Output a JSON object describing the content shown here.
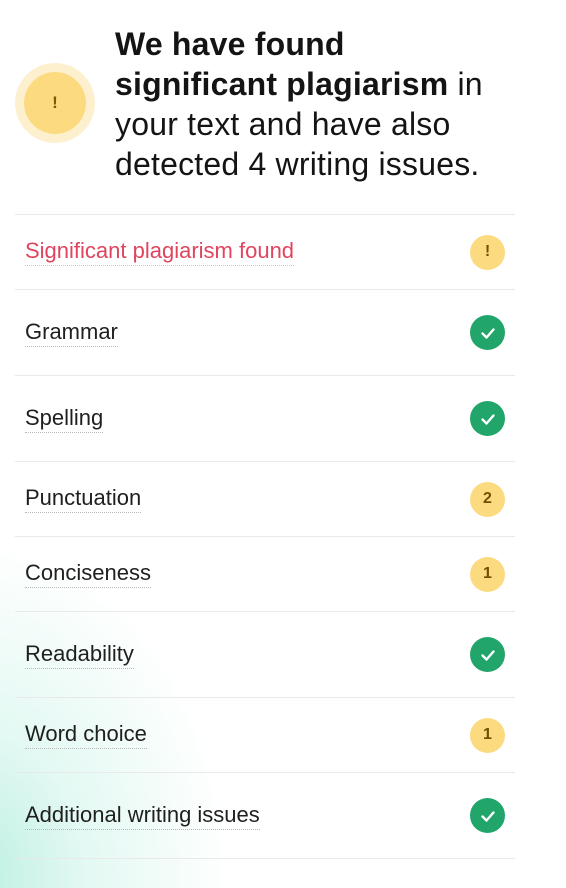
{
  "header": {
    "badge_icon": "!",
    "headline_bold_1": "We have found",
    "headline_bold_2": "significant plagiarism",
    "headline_rest_1": " in",
    "headline_rest_2": "your text and have also",
    "headline_rest_3": "detected 4 writing issues."
  },
  "checks": [
    {
      "label": "Significant plagiarism found",
      "status": "warning",
      "badge": "!"
    },
    {
      "label": "Grammar",
      "status": "ok",
      "badge": ""
    },
    {
      "label": "Spelling",
      "status": "ok",
      "badge": ""
    },
    {
      "label": "Punctuation",
      "status": "issues",
      "badge": "2"
    },
    {
      "label": "Conciseness",
      "status": "issues",
      "badge": "1"
    },
    {
      "label": "Readability",
      "status": "ok",
      "badge": ""
    },
    {
      "label": "Word choice",
      "status": "issues",
      "badge": "1"
    },
    {
      "label": "Additional writing issues",
      "status": "ok",
      "badge": ""
    }
  ],
  "colors": {
    "alert_text": "#e0445e",
    "warning_badge": "#fcdb80",
    "ok_badge": "#21a56a"
  },
  "icons": {
    "ok": "check-icon",
    "warning": "exclamation-icon"
  }
}
